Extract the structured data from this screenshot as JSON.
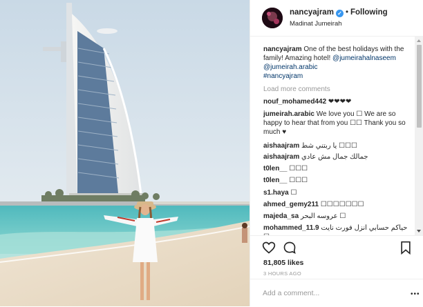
{
  "post": {
    "username": "nancyajram",
    "following_label": "Following",
    "location": "Madinat Jumeirah",
    "more_glyph": "•••"
  },
  "caption": {
    "username": "nancyajram",
    "text": "One of the best holidays with the family! Amazing hotel!",
    "mention1": "@jumeirahalnaseem",
    "mention2": "@jumeirah.arabic",
    "hashtag": "#nancyajram"
  },
  "load_more_label": "Load more comments",
  "comments": [
    {
      "user": "nouf_mohamed442",
      "text": "❤❤❤❤"
    },
    {
      "user": "jumeirah.arabic",
      "text": "We love you ☐ We are so happy to hear that from you ☐☐ Thank you so much ♥"
    },
    {
      "user": "aishaajram",
      "text": "يا ربتني شط ☐☐☐"
    },
    {
      "user": "aishaajram",
      "text": "جمالك جمال مش عادي"
    },
    {
      "user": "t0len__",
      "text": "☐☐☐"
    },
    {
      "user": "t0len__",
      "text": "☐☐☐"
    },
    {
      "user": "s1.haya",
      "text": "☐"
    },
    {
      "user": "ahmed_gemy211",
      "text": "☐☐☐☐☐☐☐"
    },
    {
      "user": "majeda_sa",
      "text": "عروسه البحر ☐"
    },
    {
      "user": "mohammed_11.9",
      "text": "حياكم حسابي انزل فورت نايت ☐"
    }
  ],
  "stats": {
    "likes": "81,805 likes",
    "time": "3 HOURS AGO"
  },
  "composer": {
    "placeholder": "Add a comment...",
    "more": "•••"
  },
  "icons": {
    "like": "heart-icon",
    "comment": "comment-icon",
    "save": "bookmark-icon",
    "verified": "verified-badge-icon"
  },
  "colors": {
    "link": "#003569",
    "verified": "#3897f0",
    "muted": "#999999"
  }
}
